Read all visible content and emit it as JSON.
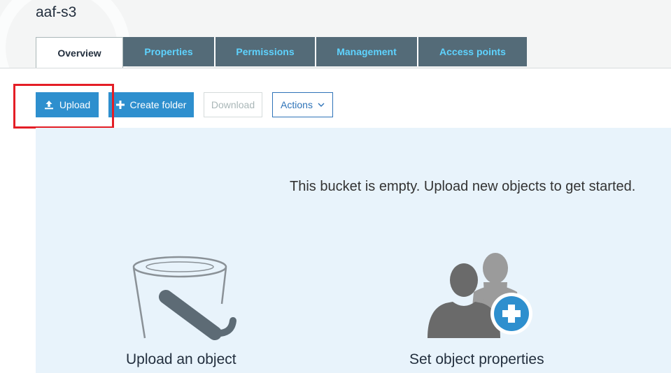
{
  "bucket": {
    "title": "aaf-s3"
  },
  "tabs": [
    {
      "label": "Overview",
      "active": true
    },
    {
      "label": "Properties",
      "active": false
    },
    {
      "label": "Permissions",
      "active": false
    },
    {
      "label": "Management",
      "active": false
    },
    {
      "label": "Access points",
      "active": false
    }
  ],
  "toolbar": {
    "upload_label": "Upload",
    "upload_icon": "upload-icon",
    "create_folder_label": "Create folder",
    "create_folder_icon": "plus-icon",
    "download_label": "Download",
    "actions_label": "Actions",
    "actions_icon": "chevron-down-icon"
  },
  "empty_state": {
    "message": "This bucket is empty. Upload new objects to get started.",
    "cards": [
      {
        "label": "Upload an object",
        "icon": "bucket-icon"
      },
      {
        "label": "Set object properties",
        "icon": "users-add-icon"
      }
    ]
  },
  "colors": {
    "tab_bg": "#546b78",
    "tab_text": "#5ed3ff",
    "primary": "#2e8fce",
    "panel_bg": "#e8f3fb",
    "highlight": "#e41e26"
  }
}
